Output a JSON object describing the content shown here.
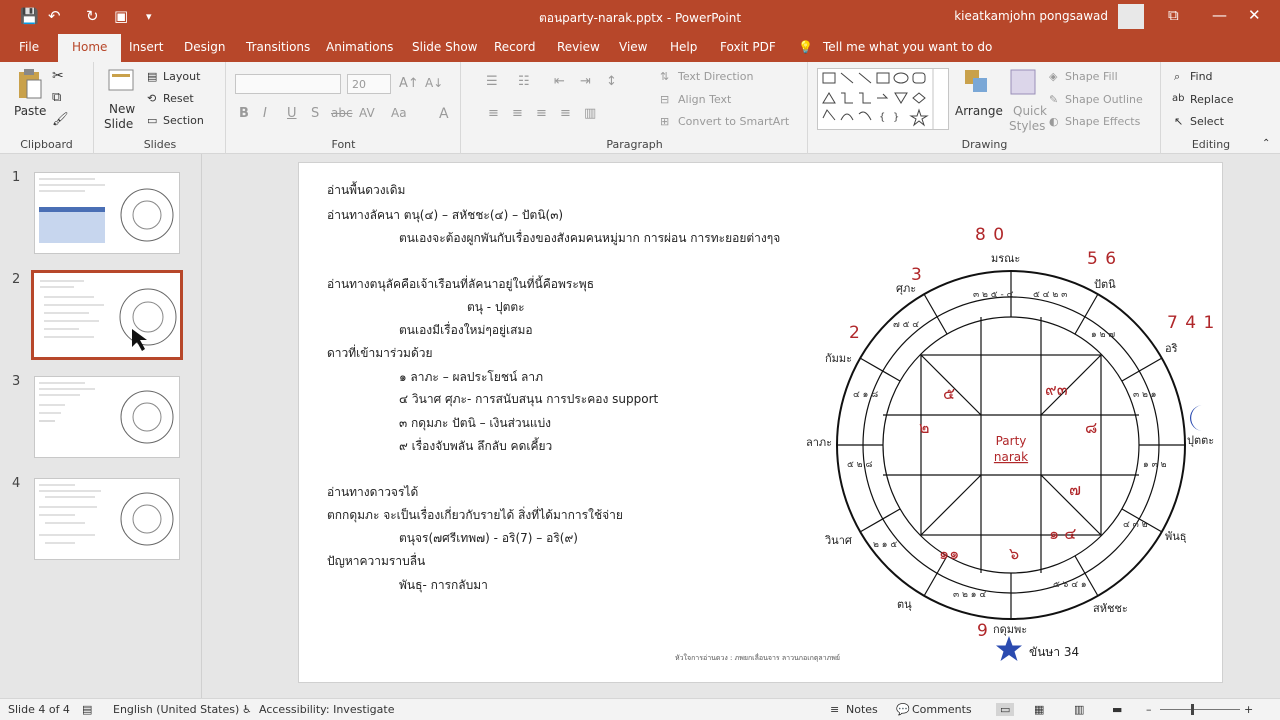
{
  "titlebar": {
    "title": "ตอนparty-narak.pptx - PowerPoint",
    "user": "kieatkamjohn pongsawad"
  },
  "tabs": [
    "File",
    "Home",
    "Insert",
    "Design",
    "Transitions",
    "Animations",
    "Slide Show",
    "Record",
    "Review",
    "View",
    "Help",
    "Foxit PDF"
  ],
  "tell_me": "Tell me what you want to do",
  "ribbon": {
    "clipboard": {
      "label": "Clipboard",
      "paste": "Paste"
    },
    "slides": {
      "label": "Slides",
      "new_slide": "New",
      "new_slide2": "Slide",
      "layout": "Layout",
      "reset": "Reset",
      "section": "Section"
    },
    "font": {
      "label": "Font",
      "size": "20"
    },
    "paragraph": {
      "label": "Paragraph",
      "text_direction": "Text Direction",
      "align_text": "Align Text",
      "smartart": "Convert to SmartArt"
    },
    "drawing": {
      "label": "Drawing",
      "arrange": "Arrange",
      "quick_styles": "Quick",
      "quick_styles2": "Styles",
      "shape_fill": "Shape Fill",
      "shape_outline": "Shape Outline",
      "shape_effects": "Shape Effects"
    },
    "editing": {
      "label": "Editing",
      "find": "Find",
      "replace": "Replace",
      "select": "Select"
    }
  },
  "slide_numbers": [
    "1",
    "2",
    "3",
    "4"
  ],
  "slide": {
    "lines": [
      "อ่านพื้นดวงเดิม",
      "อ่านทางลัคนา    ตนุ(๔) – สหัชชะ(๔) – ปัตนิ(๓)",
      "ตนเองจะต้องผูกพันกับเรื่องของสังคมคนหมู่มาก การผ่อน การทะยอยต่างๆจ",
      "อ่านทางตนุลัคคือเจ้าเรือนที่ลัคนาอยู่ในที่นี้คือพระพุธ",
      "ตนุ - ปุตตะ",
      "ตนเองมีเรื่องใหม่ๆอยู่เสมอ",
      "ดาวที่เข้ามาร่วมด้วย",
      "๑ ลาภะ – ผลประโยชน์ ลาภ",
      "๔ วินาศ ศุภะ- การสนับสนุน การประคอง support",
      "๓ กดุมภะ  ปัตนิ – เงินส่วนแบ่ง",
      "๙ เรื่องจับพลัน ลึกลับ คดเคี้ยว",
      "อ่านทางดาวจรได้",
      "ตกกดุมภะ จะเป็นเรื่องเกี่ยวกับรายได้ สิ่งที่ได้มาการใช้จ่าย",
      "ตนุจร(๗ศรีเทพ๗) - อริ(7) – อริ(๙)",
      "ปัญหาความราบลื่น",
      "พันธุ- การกลับมา"
    ],
    "footer": "หัวใจการอ่านดวง : ภพยกเลื่อนจาร ลาวนกอเกตุลาภพย์",
    "chart_center": [
      "Party",
      "narak"
    ],
    "house_labels": [
      "มรณะ",
      "ปัตนิ",
      "อริ",
      "ปุตตะ",
      "พันธุ",
      "สหัชชะ",
      "กดุมพะ",
      "ตนุ",
      "วินาศ",
      "ลาภะ",
      "กัมมะ",
      "ศุภะ"
    ],
    "red_numbers": [
      "8 0",
      "5 6",
      "7 4 1",
      "3",
      "2",
      "9"
    ],
    "star_label": "ขันษา 34",
    "inner_numbers": [
      "๕",
      "๒",
      "๙๓",
      "๘",
      "๗",
      "๑ ๔",
      "๖",
      "๑๑"
    ]
  },
  "statusbar": {
    "slide": "Slide 4 of 4",
    "language": "English (United States)",
    "accessibility": "Accessibility: Investigate",
    "notes": "Notes",
    "comments": "Comments"
  }
}
